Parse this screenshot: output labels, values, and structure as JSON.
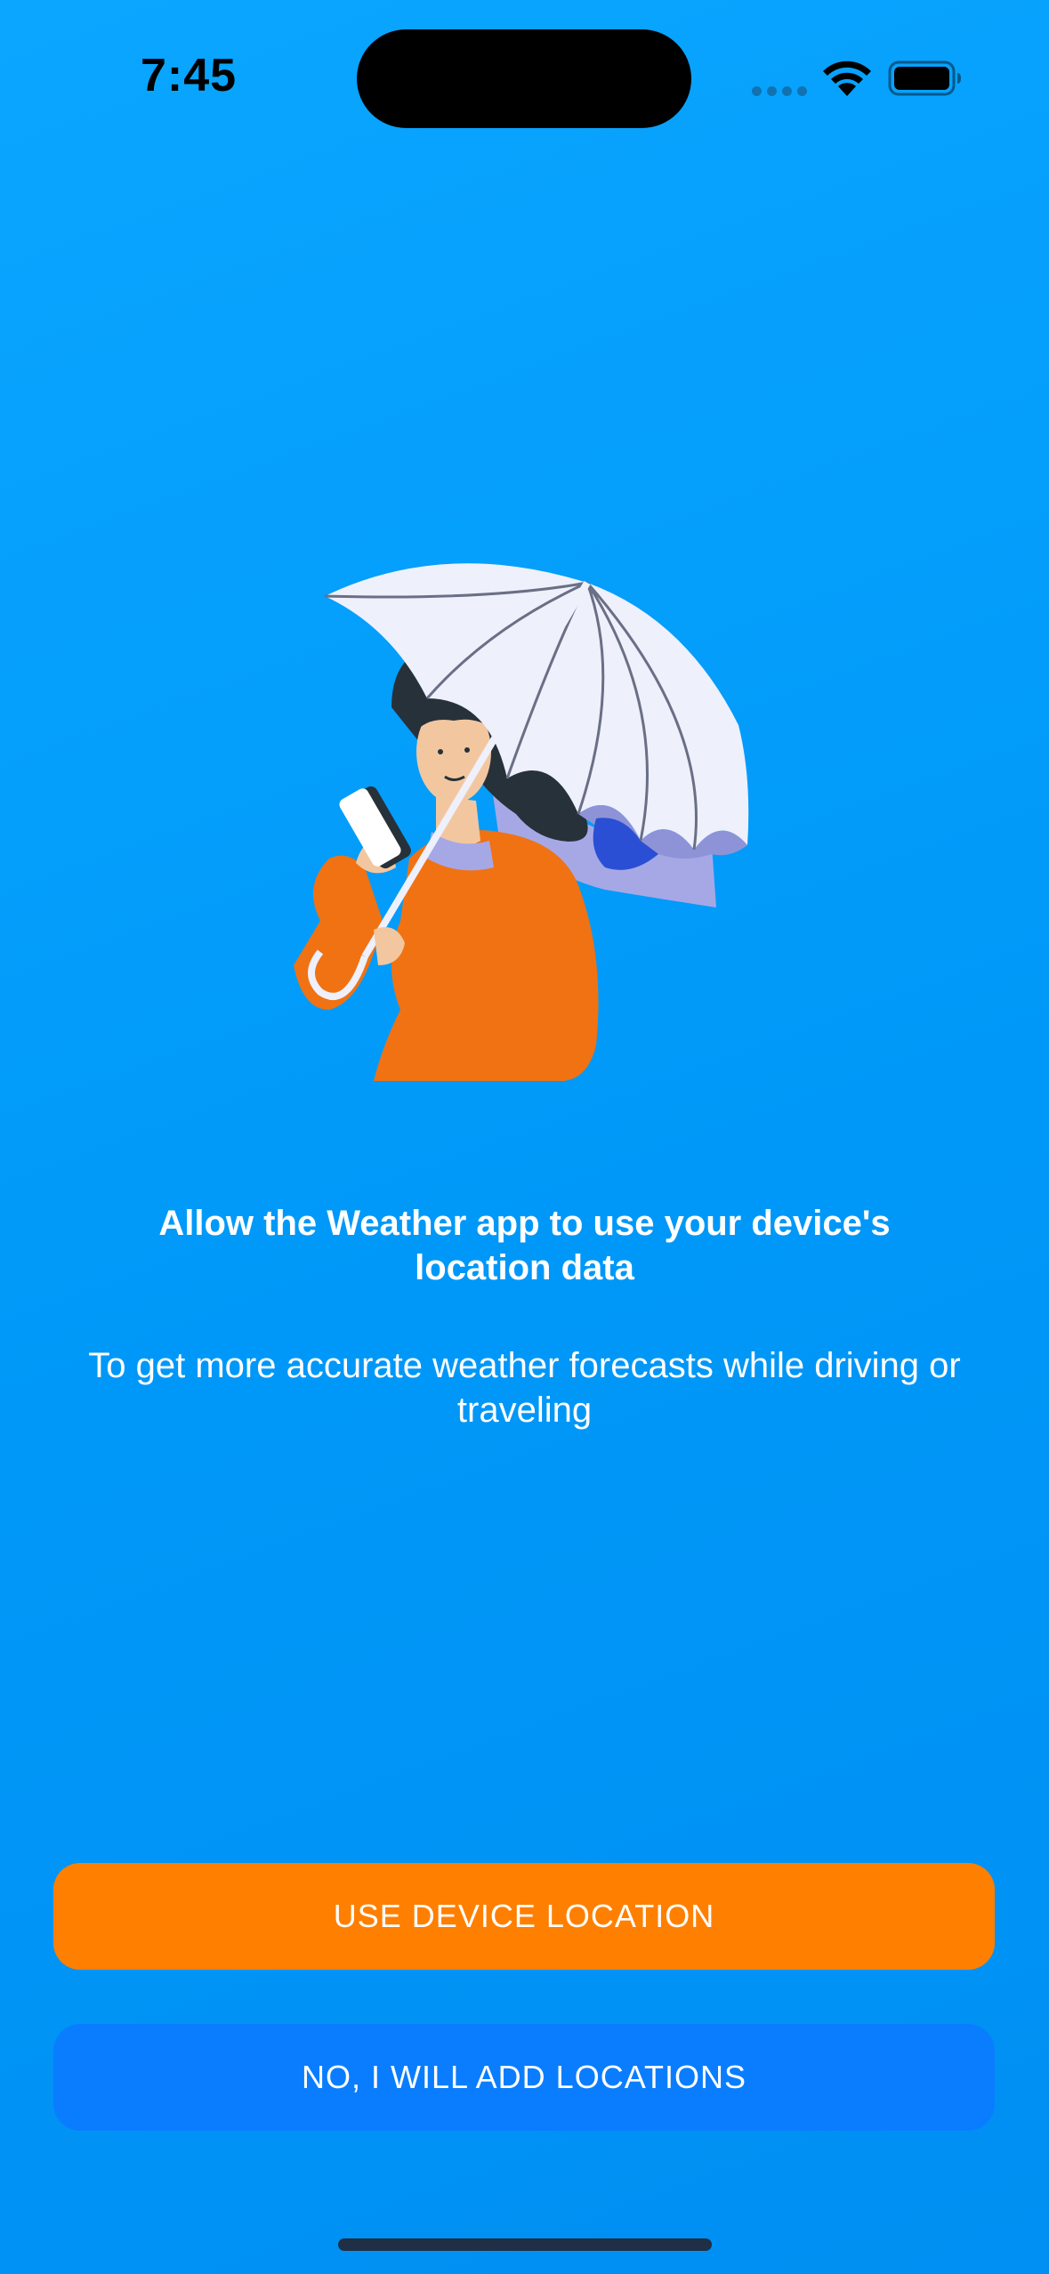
{
  "status_bar": {
    "time": "7:45"
  },
  "onboarding": {
    "title": "Allow the Weather app to use your device's location data",
    "subtitle": "To get more accurate weather forecasts while driving or traveling",
    "illustration": "woman-with-umbrella-and-phone"
  },
  "actions": {
    "primary_label": "USE DEVICE LOCATION",
    "secondary_label": "NO, I WILL ADD LOCATIONS"
  },
  "colors": {
    "background": "#0aa6ff",
    "primary_button": "#ff7f00",
    "secondary_button": "#0a7dff"
  }
}
